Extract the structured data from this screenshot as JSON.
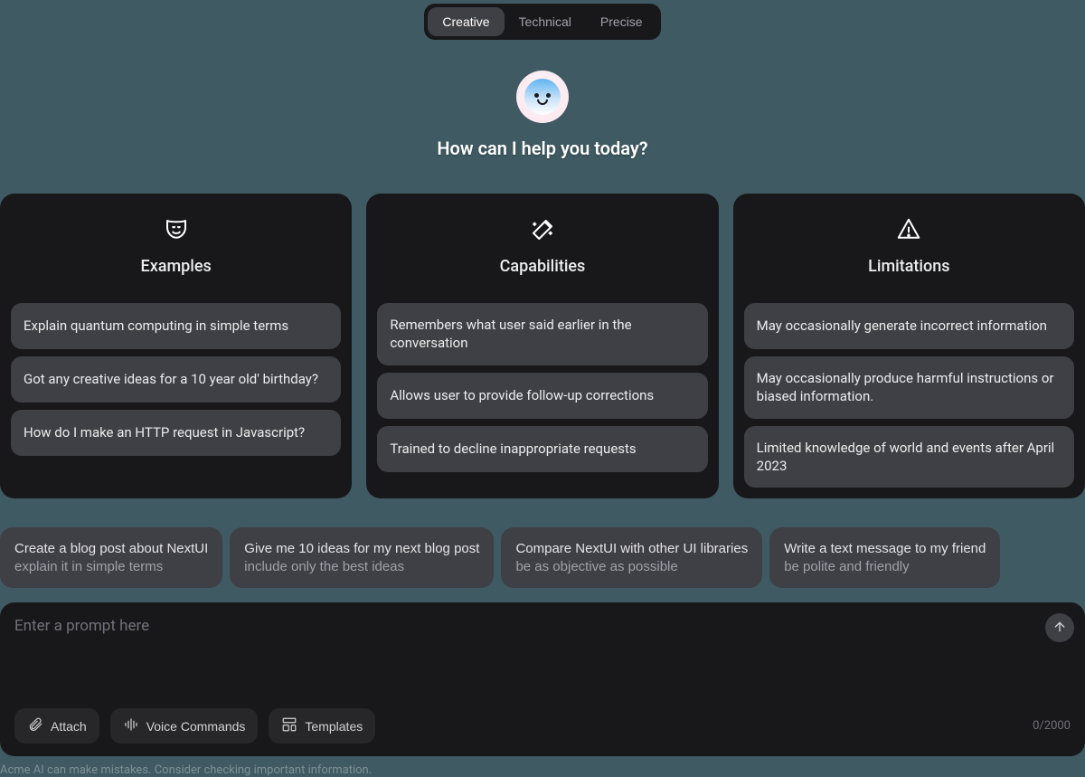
{
  "tabs": [
    "Creative",
    "Technical",
    "Precise"
  ],
  "active_tab_index": 0,
  "hero_title": "How can I help you today?",
  "cards": [
    {
      "title": "Examples",
      "items": [
        "Explain quantum computing in simple terms",
        "Got any creative ideas for a 10 year old' birthday?",
        "How do I make an HTTP request in Javascript?"
      ]
    },
    {
      "title": "Capabilities",
      "items": [
        "Remembers what user said earlier in the conversation",
        "Allows user to provide follow-up corrections",
        "Trained to decline inappropriate requests"
      ]
    },
    {
      "title": "Limitations",
      "items": [
        "May occasionally generate incorrect information",
        "May occasionally produce harmful instructions or biased information.",
        "Limited knowledge of world and events after April 2023"
      ]
    }
  ],
  "suggestions": [
    {
      "title": "Create a blog post about NextUI",
      "sub": "explain it in simple terms"
    },
    {
      "title": "Give me 10 ideas for my next blog post",
      "sub": "include only the best ideas"
    },
    {
      "title": "Compare NextUI with other UI libraries",
      "sub": "be as objective as possible"
    },
    {
      "title": "Write a text message to my friend",
      "sub": "be polite and friendly"
    }
  ],
  "prompt": {
    "placeholder": "Enter a prompt here",
    "value": "",
    "actions": {
      "attach": "Attach",
      "voice": "Voice Commands",
      "templates": "Templates"
    },
    "char_count": "0/2000"
  },
  "disclaimer": "Acme AI can make mistakes. Consider checking important information."
}
